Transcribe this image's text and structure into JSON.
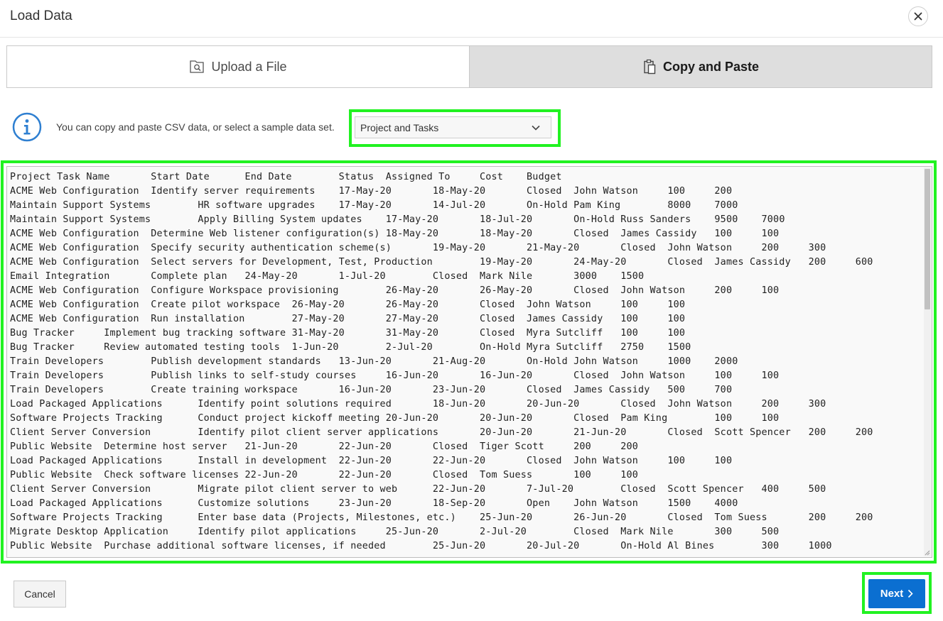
{
  "dialog": {
    "title": "Load Data",
    "close_icon": "close-icon"
  },
  "tabs": [
    {
      "label": "Upload a File",
      "icon": "file-search-icon",
      "active": false
    },
    {
      "label": "Copy and Paste",
      "icon": "clipboard-icon",
      "active": true
    }
  ],
  "info": {
    "icon": "info-icon",
    "text": "You can copy and paste CSV data, or select a sample data set."
  },
  "sample_select": {
    "selected": "Project and Tasks",
    "icon": "chevron-down-icon"
  },
  "csv_text": "Project Task Name\tStart Date\tEnd Date\tStatus\tAssigned To\tCost\tBudget\nACME Web Configuration\tIdentify server requirements\t17-May-20\t18-May-20\tClosed\tJohn Watson\t100\t200\nMaintain Support Systems\tHR software upgrades\t17-May-20\t14-Jul-20\tOn-Hold\tPam King\t8000\t7000\nMaintain Support Systems\tApply Billing System updates\t17-May-20\t18-Jul-20\tOn-Hold\tRuss Sanders\t9500\t7000\nACME Web Configuration\tDetermine Web listener configuration(s)\t18-May-20\t18-May-20\tClosed\tJames Cassidy\t100\t100\nACME Web Configuration\tSpecify security authentication scheme(s)\t19-May-20\t21-May-20\tClosed\tJohn Watson\t200\t300\nACME Web Configuration\tSelect servers for Development, Test, Production\t19-May-20\t24-May-20\tClosed\tJames Cassidy\t200\t600\nEmail Integration\tComplete plan\t24-May-20\t1-Jul-20\tClosed\tMark Nile\t3000\t1500\nACME Web Configuration\tConfigure Workspace provisioning\t26-May-20\t26-May-20\tClosed\tJohn Watson\t200\t100\nACME Web Configuration\tCreate pilot workspace\t26-May-20\t26-May-20\tClosed\tJohn Watson\t100\t100\nACME Web Configuration\tRun installation\t27-May-20\t27-May-20\tClosed\tJames Cassidy\t100\t100\nBug Tracker\tImplement bug tracking software\t31-May-20\t31-May-20\tClosed\tMyra Sutcliff\t100\t100\nBug Tracker\tReview automated testing tools\t1-Jun-20\t2-Jul-20\tOn-Hold\tMyra Sutcliff\t2750\t1500\nTrain Developers\tPublish development standards\t13-Jun-20\t21-Aug-20\tOn-Hold\tJohn Watson\t1000\t2000\nTrain Developers\tPublish links to self-study courses\t16-Jun-20\t16-Jun-20\tClosed\tJohn Watson\t100\t100\nTrain Developers\tCreate training workspace\t16-Jun-20\t23-Jun-20\tClosed\tJames Cassidy\t500\t700\nLoad Packaged Applications\tIdentify point solutions required\t18-Jun-20\t20-Jun-20\tClosed\tJohn Watson\t200\t300\nSoftware Projects Tracking\tConduct project kickoff meeting\t20-Jun-20\t20-Jun-20\tClosed\tPam King\t100\t100\nClient Server Conversion\tIdentify pilot client server applications\t20-Jun-20\t21-Jun-20\tClosed\tScott Spencer\t200\t200\nPublic Website\tDetermine host server\t21-Jun-20\t22-Jun-20\tClosed\tTiger Scott\t200\t200\nLoad Packaged Applications\tInstall in development\t22-Jun-20\t22-Jun-20\tClosed\tJohn Watson\t100\t100\nPublic Website\tCheck software licenses\t22-Jun-20\t22-Jun-20\tClosed\tTom Suess\t100\t100\nClient Server Conversion\tMigrate pilot client server to web\t22-Jun-20\t7-Jul-20\tClosed\tScott Spencer\t400\t500\nLoad Packaged Applications\tCustomize solutions\t23-Jun-20\t18-Sep-20\tOpen\tJohn Watson\t1500\t4000\nSoftware Projects Tracking\tEnter base data (Projects, Milestones, etc.)\t25-Jun-20\t26-Jun-20\tClosed\tTom Suess\t200\t200\nMigrate Desktop Application\tIdentify pilot applications\t25-Jun-20\t2-Jul-20\tClosed\tMark Nile\t300\t500\nPublic Website\tPurchase additional software licenses, if needed\t25-Jun-20\t20-Jul-20\tOn-Hold\tAl Bines\t300\t1000",
  "footer": {
    "cancel_label": "Cancel",
    "next_label": "Next",
    "next_icon": "chevron-right-icon"
  },
  "colors": {
    "highlight": "#21f221",
    "primary": "#0b6fd1",
    "info_icon": "#2e7fd1",
    "active_tab": "#dedede"
  }
}
